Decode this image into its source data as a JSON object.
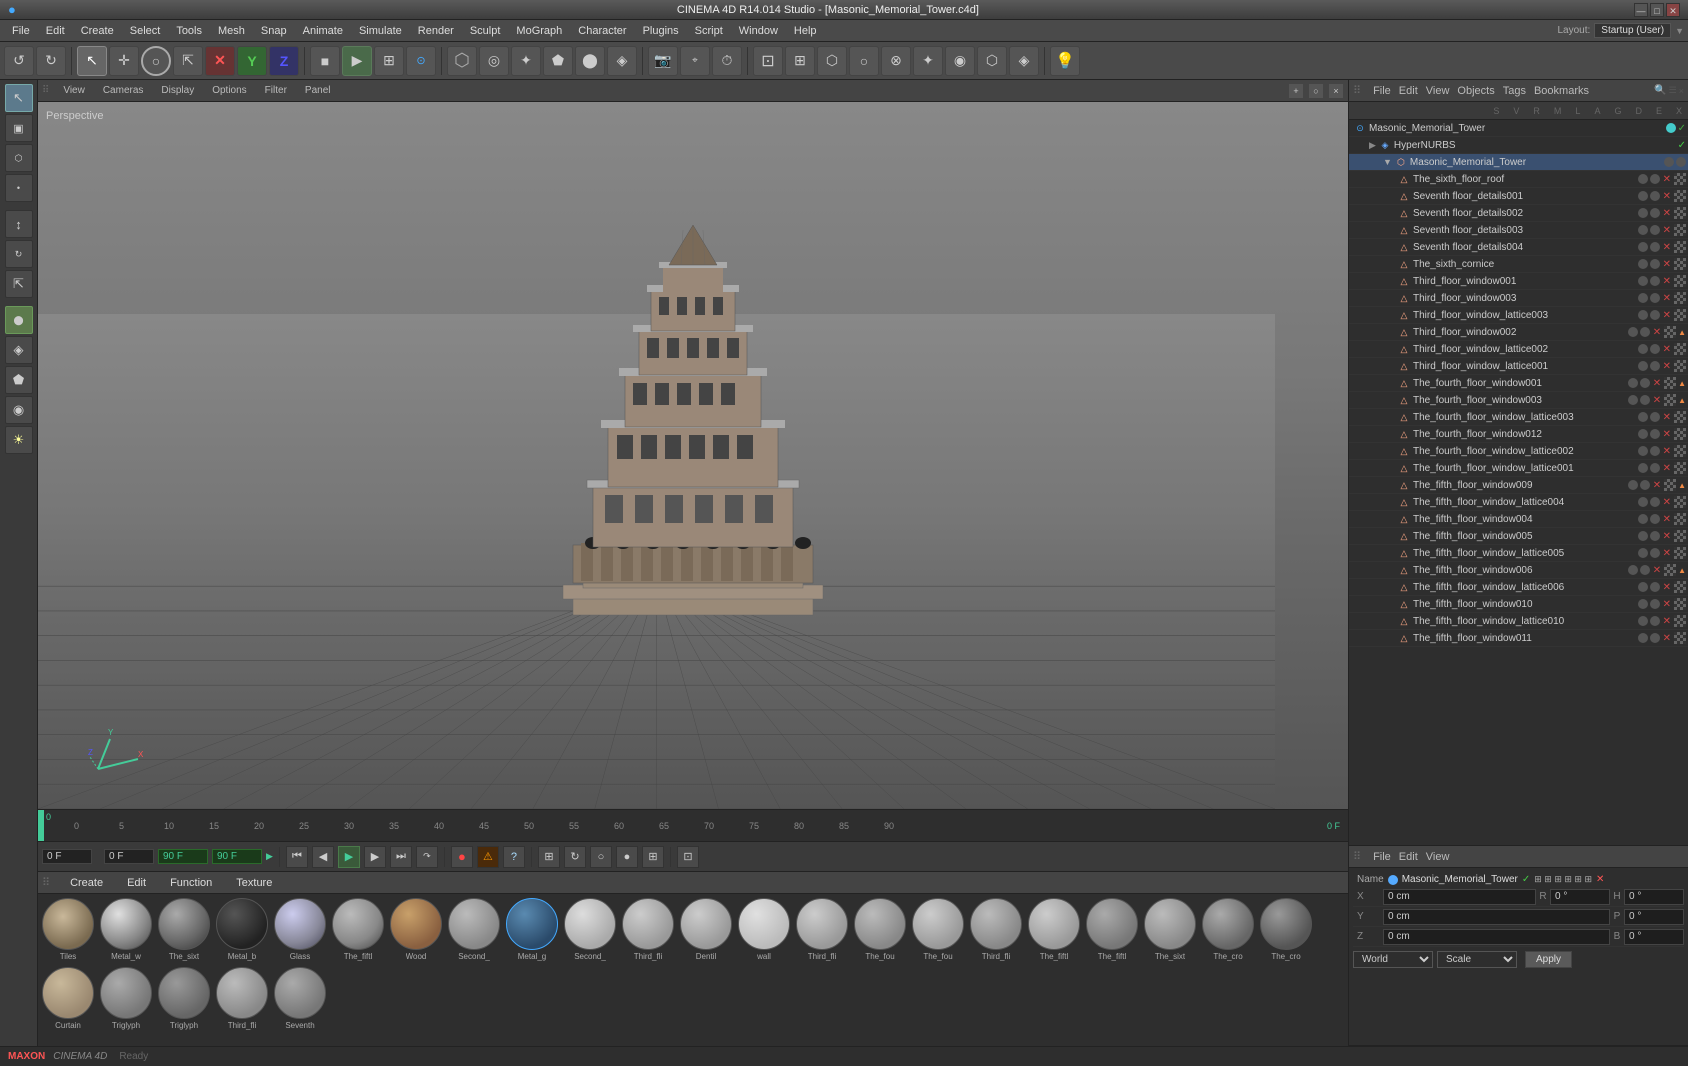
{
  "window": {
    "title": "CINEMA 4D R14.014 Studio - [Masonic_Memorial_Tower.c4d]",
    "app_name": "CINEMA 4D R14.014 Studio"
  },
  "title_controls": [
    "—",
    "□",
    "✕"
  ],
  "menu_bar": {
    "items": [
      "File",
      "Edit",
      "Create",
      "Select",
      "Tools",
      "Mesh",
      "Snap",
      "Animate",
      "Simulate",
      "Render",
      "Sculpt",
      "MoGraph",
      "Character",
      "Plugins",
      "Script",
      "Window",
      "Help"
    ],
    "layout_label": "Layout:",
    "layout_value": "Startup (User)"
  },
  "viewport": {
    "tabs": [
      "View",
      "Cameras",
      "Display",
      "Options",
      "Filter",
      "Panel"
    ],
    "label": "Perspective",
    "frame_label": "0"
  },
  "timeline": {
    "markers": [
      "0",
      "5",
      "10",
      "15",
      "20",
      "25",
      "30",
      "35",
      "40",
      "45",
      "50",
      "55",
      "60",
      "65",
      "70",
      "75",
      "80",
      "85",
      "90"
    ],
    "end_label": "0 F"
  },
  "transport": {
    "frame_current": "0 F",
    "frame_display": "0 F",
    "frame_end": "90 F",
    "fps": "90 F"
  },
  "object_manager": {
    "menu_items": [
      "File",
      "Edit",
      "View",
      "Objects",
      "Tags",
      "Bookmarks"
    ],
    "col_headers": [
      "S",
      "V",
      "R",
      "M",
      "L",
      "A",
      "G",
      "D",
      "E",
      "X"
    ],
    "root_item": "Masonic_Memorial_Tower",
    "items": [
      {
        "indent": 1,
        "name": "HyperNURBS",
        "type": "nurbs"
      },
      {
        "indent": 2,
        "name": "Masonic_Memorial_Tower",
        "type": "obj",
        "selected": true
      },
      {
        "indent": 3,
        "name": "The_sixth_floor_roof",
        "type": "mesh"
      },
      {
        "indent": 3,
        "name": "Seventh floor_details001",
        "type": "mesh"
      },
      {
        "indent": 3,
        "name": "Seventh floor_details002",
        "type": "mesh"
      },
      {
        "indent": 3,
        "name": "Seventh floor_details003",
        "type": "mesh"
      },
      {
        "indent": 3,
        "name": "Seventh floor_details004",
        "type": "mesh"
      },
      {
        "indent": 3,
        "name": "The_sixth_cornice",
        "type": "mesh"
      },
      {
        "indent": 3,
        "name": "Third_floor_window001",
        "type": "mesh"
      },
      {
        "indent": 3,
        "name": "Third_floor_window003",
        "type": "mesh"
      },
      {
        "indent": 3,
        "name": "Third_floor_window_lattice003",
        "type": "mesh"
      },
      {
        "indent": 3,
        "name": "Third_floor_window002",
        "type": "mesh"
      },
      {
        "indent": 3,
        "name": "Third_floor_window_lattice002",
        "type": "mesh"
      },
      {
        "indent": 3,
        "name": "Third_floor_window_lattice001",
        "type": "mesh"
      },
      {
        "indent": 3,
        "name": "The_fourth_floor_window001",
        "type": "mesh"
      },
      {
        "indent": 3,
        "name": "The_fourth_floor_window003",
        "type": "mesh"
      },
      {
        "indent": 3,
        "name": "The_fourth_floor_window_lattice003",
        "type": "mesh"
      },
      {
        "indent": 3,
        "name": "The_fourth_floor_window012",
        "type": "mesh"
      },
      {
        "indent": 3,
        "name": "The_fourth_floor_window_lattice002",
        "type": "mesh"
      },
      {
        "indent": 3,
        "name": "The_fourth_floor_window_lattice001",
        "type": "mesh"
      },
      {
        "indent": 3,
        "name": "The_fifth_floor_window009",
        "type": "mesh"
      },
      {
        "indent": 3,
        "name": "The_fifth_floor_window_lattice004",
        "type": "mesh"
      },
      {
        "indent": 3,
        "name": "The_fifth_floor_window004",
        "type": "mesh"
      },
      {
        "indent": 3,
        "name": "The_fifth_floor_window005",
        "type": "mesh"
      },
      {
        "indent": 3,
        "name": "The_fifth_floor_window_lattice005",
        "type": "mesh"
      },
      {
        "indent": 3,
        "name": "The_fifth_floor_window006",
        "type": "mesh"
      },
      {
        "indent": 3,
        "name": "The_fifth_floor_window_lattice006",
        "type": "mesh"
      },
      {
        "indent": 3,
        "name": "The_fifth_floor_window010",
        "type": "mesh"
      },
      {
        "indent": 3,
        "name": "The_fifth_floor_window_lattice010",
        "type": "mesh"
      },
      {
        "indent": 3,
        "name": "The_fifth_floor_window011",
        "type": "mesh"
      }
    ]
  },
  "attr_manager": {
    "menu_items": [
      "File",
      "Edit",
      "View"
    ],
    "object_name": "Masonic_Memorial_Tower",
    "coords": {
      "x": {
        "label": "X",
        "pos": "0 cm",
        "rot_label": "R",
        "rot": "0 °"
      },
      "y": {
        "label": "Y",
        "pos": "0 cm",
        "rot_label": "P",
        "rot": "0 °"
      },
      "z": {
        "label": "Z",
        "pos": "0 cm",
        "rot_label": "B",
        "rot": "0 °"
      },
      "size_label": "H",
      "size": "0 °"
    },
    "dropdown1": "World",
    "dropdown2": "Scale",
    "apply_button": "Apply"
  },
  "materials": [
    {
      "name": "Tiles",
      "color": "#8a7a6a",
      "style": "flat"
    },
    {
      "name": "Metal_w",
      "color": "#999",
      "style": "metal"
    },
    {
      "name": "The_sixt",
      "color": "#7a7a7a",
      "style": "mid"
    },
    {
      "name": "Metal_b",
      "color": "#222",
      "style": "dark"
    },
    {
      "name": "Glass",
      "color": "#9ab",
      "style": "glass"
    },
    {
      "name": "The_fiftl",
      "color": "#888",
      "style": "flat"
    },
    {
      "name": "Wood",
      "color": "#8a6a4a",
      "style": "wood"
    },
    {
      "name": "Second_",
      "color": "#888",
      "style": "flat"
    },
    {
      "name": "Metal_g",
      "color": "#2a4a6a",
      "style": "metal2"
    },
    {
      "name": "Second_",
      "color": "#aaa",
      "style": "flat2"
    },
    {
      "name": "Third_fli",
      "color": "#aaa",
      "style": "flat3"
    },
    {
      "name": "Dentil",
      "color": "#999",
      "style": "flat4"
    },
    {
      "name": "wall",
      "color": "#bbb",
      "style": "flat5"
    },
    {
      "name": "Third_fli",
      "color": "#aaa",
      "style": "flat6"
    },
    {
      "name": "The_fou",
      "color": "#999",
      "style": "flat7"
    },
    {
      "name": "The_fou",
      "color": "#aaa",
      "style": "flat8"
    },
    {
      "name": "Third_fli",
      "color": "#999",
      "style": "flat9"
    },
    {
      "name": "The_fiftl",
      "color": "#aaa",
      "style": "flat10"
    },
    {
      "name": "The_fiftl",
      "color": "#888",
      "style": "flat11"
    },
    {
      "name": "The_sixt",
      "color": "#999",
      "style": "flat12"
    },
    {
      "name": "The_cro",
      "color": "#777",
      "style": "flat13"
    },
    {
      "name": "The_cro",
      "color": "#666",
      "style": "flat14"
    },
    {
      "name": "Curtain",
      "color": "#9a8a7a",
      "style": "flat15"
    },
    {
      "name": "Triglyph",
      "color": "#888",
      "style": "flat16"
    },
    {
      "name": "Triglyph",
      "color": "#777",
      "style": "flat17"
    },
    {
      "name": "Third_fli",
      "color": "#999",
      "style": "flat18"
    },
    {
      "name": "Seventh",
      "color": "#888",
      "style": "flat19"
    }
  ],
  "left_toolbar": {
    "buttons": [
      "↺",
      "↻",
      "↖",
      "+",
      "⊕",
      "○",
      "△",
      "⬡",
      "⌂",
      "✎",
      "◈",
      "⬟",
      "✦",
      "⬤"
    ]
  },
  "main_toolbar": {
    "groups": [
      {
        "buttons": [
          "↺",
          "↻"
        ]
      },
      {
        "buttons": [
          "↖",
          "+",
          "○",
          "△",
          "✕",
          "Y",
          "Z"
        ]
      },
      {
        "buttons": [
          "■",
          "►",
          "⊞",
          "○",
          "✦",
          "◉",
          "⬡"
        ]
      },
      {
        "buttons": [
          "⊡",
          "◎",
          "✦",
          "⬡",
          "⬟",
          "⬤",
          "◈"
        ]
      },
      {
        "buttons": [
          "⊞",
          "⬡",
          "○",
          "△",
          "⊗",
          "✦",
          "◉",
          "⬡",
          "◈"
        ]
      },
      {
        "buttons": [
          "⊙"
        ]
      }
    ]
  }
}
